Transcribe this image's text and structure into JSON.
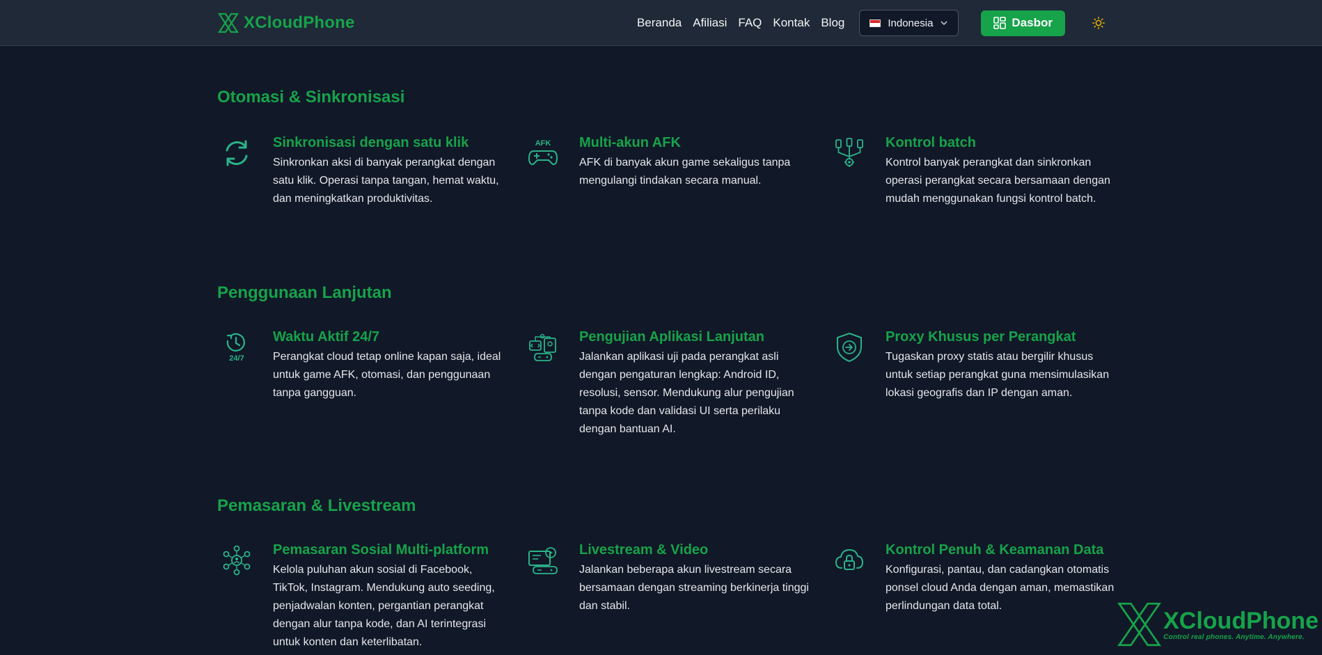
{
  "brand": {
    "name": "XCloudPhone",
    "accent": "#16a34a",
    "background": "#111827"
  },
  "nav": {
    "links": [
      "Beranda",
      "Afiliasi",
      "FAQ",
      "Kontak",
      "Blog"
    ],
    "language": {
      "selected": "Indonesia",
      "flag_icon": "flag-indonesia-icon"
    },
    "dashboard_label": "Dasbor",
    "theme_icon": "sun-icon"
  },
  "sections": [
    {
      "title": "Otomasi & Sinkronisasi",
      "features": [
        {
          "icon": "sync-icon",
          "title": "Sinkronisasi dengan satu klik",
          "desc": "Sinkronkan aksi di banyak perangkat dengan satu klik. Operasi tanpa tangan, hemat waktu, dan meningkatkan produktivitas."
        },
        {
          "icon": "afk-gamepad-icon",
          "icon_text": "AFK",
          "title": "Multi-akun AFK",
          "desc": "AFK di banyak akun game sekaligus tanpa mengulangi tindakan secara manual."
        },
        {
          "icon": "batch-control-icon",
          "title": "Kontrol batch",
          "desc": "Kontrol banyak perangkat dan sinkronkan operasi perangkat secara bersamaan dengan mudah menggunakan fungsi kontrol batch."
        }
      ]
    },
    {
      "title": "Penggunaan Lanjutan",
      "features": [
        {
          "icon": "clock-24-7-icon",
          "icon_text": "24/7",
          "title": "Waktu Aktif 24/7",
          "desc": "Perangkat cloud tetap online kapan saja, ideal untuk game AFK, otomasi, dan penggunaan tanpa gangguan."
        },
        {
          "icon": "app-testing-icon",
          "title": "Pengujian Aplikasi Lanjutan",
          "desc": "Jalankan aplikasi uji pada perangkat asli dengan pengaturan lengkap: Android ID, resolusi, sensor. Mendukung alur pengujian tanpa kode dan validasi UI serta perilaku dengan bantuan AI."
        },
        {
          "icon": "shield-proxy-icon",
          "title": "Proxy Khusus per Perangkat",
          "desc": "Tugaskan proxy statis atau bergilir khusus untuk setiap perangkat guna mensimulasikan lokasi geografis dan IP dengan aman."
        }
      ]
    },
    {
      "title": "Pemasaran & Livestream",
      "features": [
        {
          "icon": "social-network-icon",
          "title": "Pemasaran Sosial Multi-platform",
          "desc": "Kelola puluhan akun sosial di Facebook, TikTok, Instagram. Mendukung auto seeding, penjadwalan konten, pergantian perangkat dengan alur tanpa kode, dan AI terintegrasi untuk konten dan keterlibatan."
        },
        {
          "icon": "livestream-icon",
          "title": "Livestream & Video",
          "desc": "Jalankan beberapa akun livestream secara bersamaan dengan streaming berkinerja tinggi dan stabil."
        },
        {
          "icon": "cloud-lock-icon",
          "title": "Kontrol Penuh & Keamanan Data",
          "desc": "Konfigurasi, pantau, dan cadangkan otomatis ponsel cloud Anda dengan aman, memastikan perlindungan data total."
        }
      ]
    }
  ],
  "watermark": {
    "name": "XCloudPhone",
    "tagline": "Control real phones. Anytime. Anywhere."
  }
}
